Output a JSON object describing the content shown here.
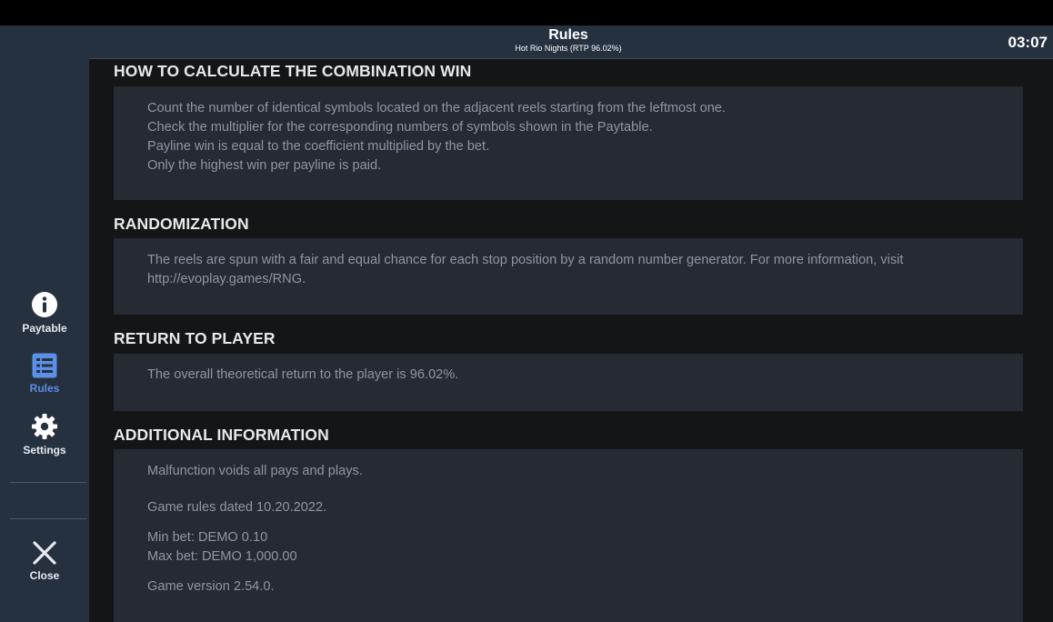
{
  "header": {
    "title": "Rules",
    "subtitle": "Hot Rio Nights (RTP 96.02%)",
    "clock": "03:07"
  },
  "sidebar": {
    "items": [
      {
        "label": "Paytable",
        "icon": "info-icon",
        "active": false
      },
      {
        "label": "Rules",
        "icon": "list-icon",
        "active": true
      },
      {
        "label": "Settings",
        "icon": "gear-icon",
        "active": false
      },
      {
        "label": "Close",
        "icon": "close-icon",
        "active": false
      }
    ]
  },
  "sections": {
    "combination": {
      "title": "HOW TO CALCULATE THE COMBINATION WIN",
      "lines": [
        "Count the number of identical symbols located on the adjacent reels starting from the leftmost one.",
        "Check the multiplier for the corresponding numbers of symbols shown in the Paytable.",
        "Payline win is equal to the coefficient multiplied by the bet.",
        "Only the highest win per payline is paid."
      ]
    },
    "randomization": {
      "title": "RANDOMIZATION",
      "text": "The reels are spun with a fair and equal chance for each stop position by a random number generator. For more information, visit http://evoplay.games/RNG."
    },
    "rtp": {
      "title": "RETURN TO PLAYER",
      "text": "The overall theoretical return to the player is 96.02%."
    },
    "additional": {
      "title": "ADDITIONAL INFORMATION",
      "malfunction": "Malfunction voids all pays and plays.",
      "dated": "Game rules dated 10.20.2022.",
      "min_bet": "Min bet: DEMO 0.10",
      "max_bet": "Max bet: DEMO 1,000.00",
      "version": "Game version 2.54.0."
    }
  },
  "colors": {
    "sidebar_bg": "#263140",
    "content_bg": "#141517",
    "panel_bg": "#252a33",
    "active_accent": "#5b8fe8",
    "body_text": "#8f96a3"
  }
}
